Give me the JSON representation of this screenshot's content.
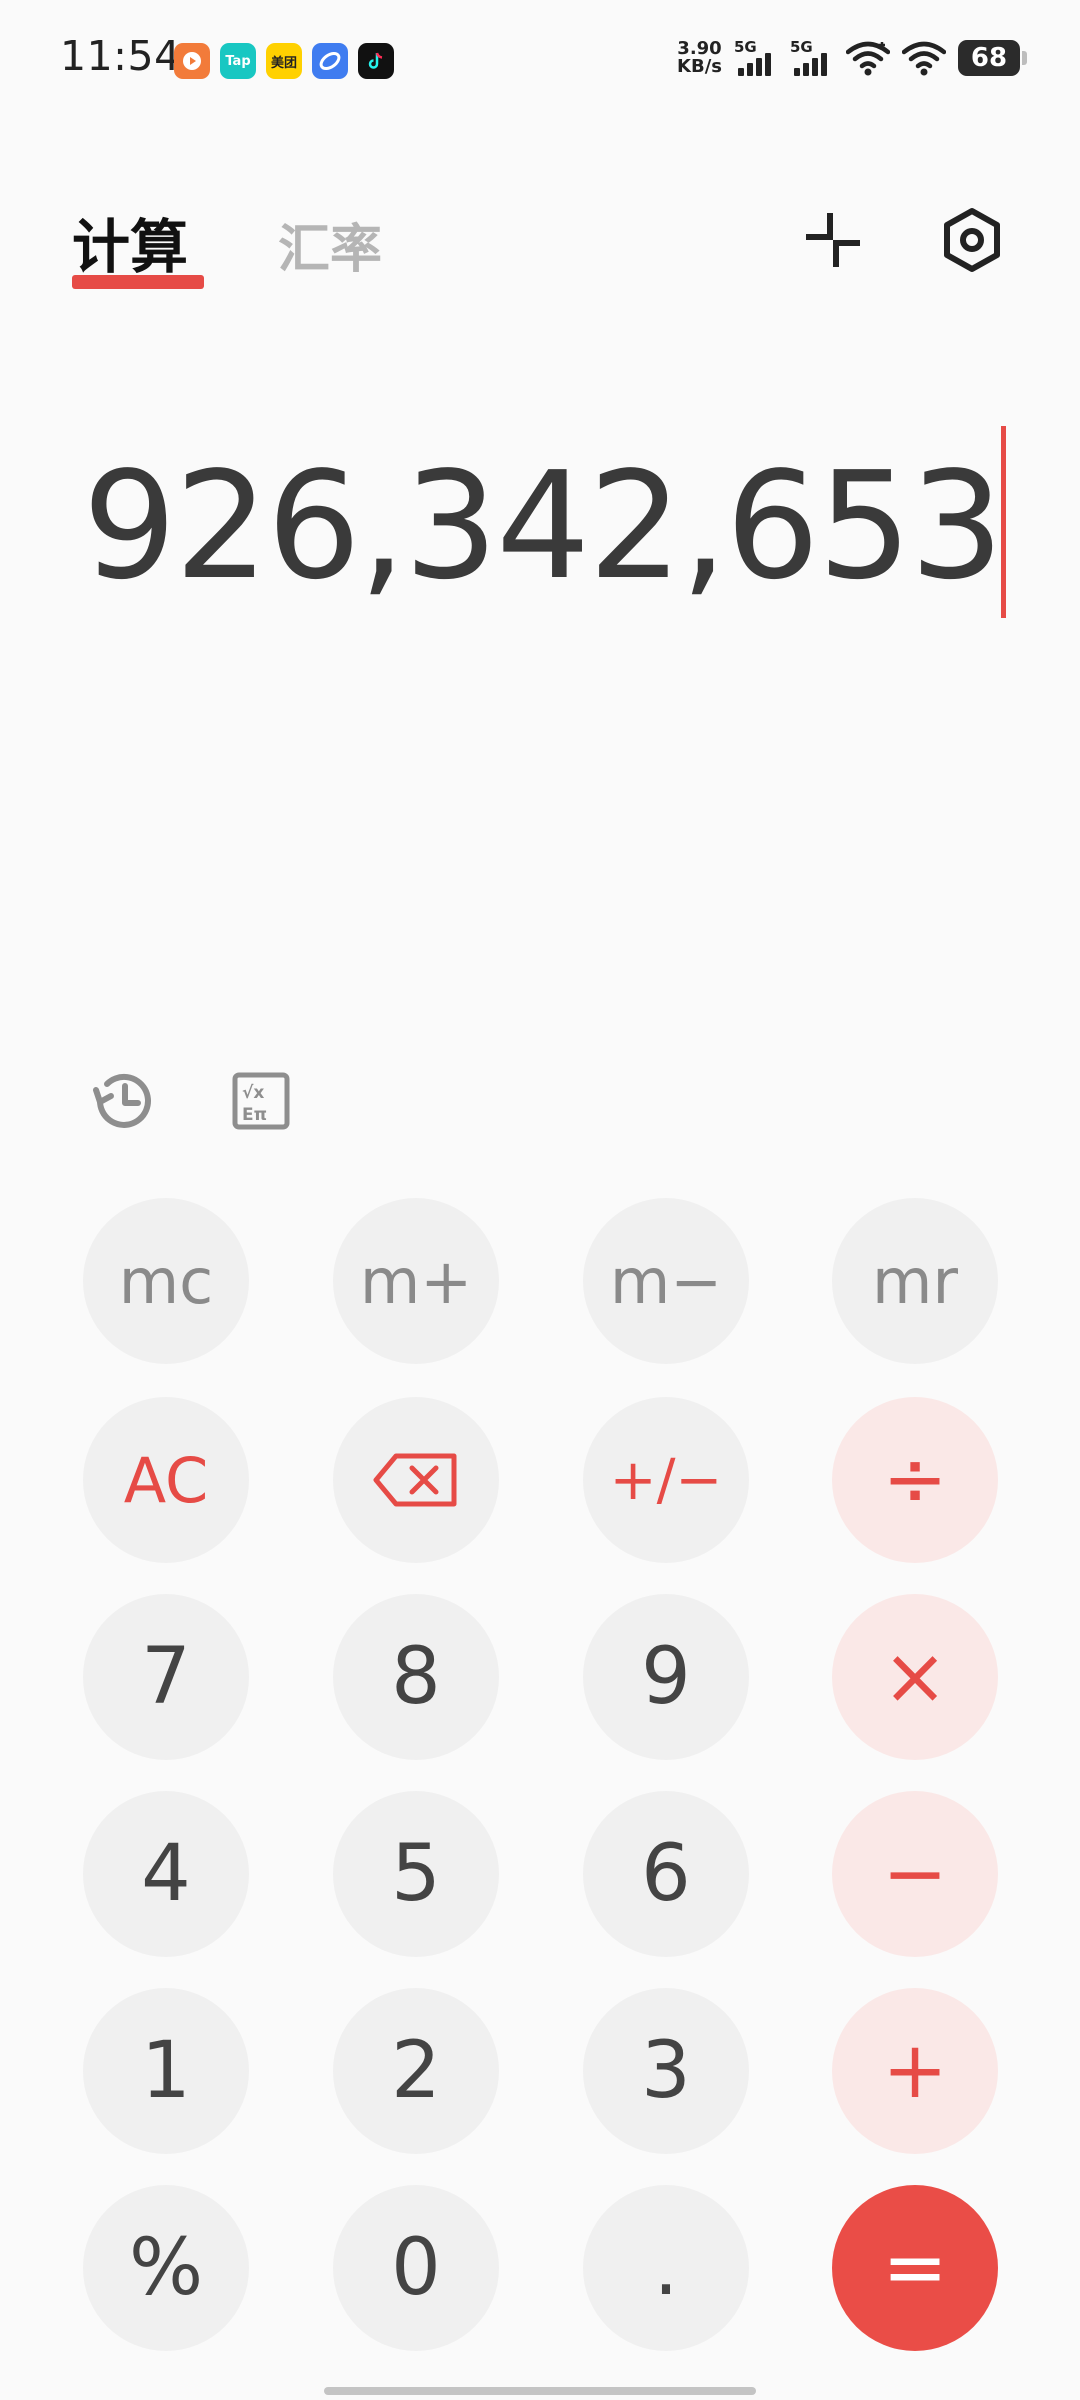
{
  "status_bar": {
    "time": "11:54",
    "apps": [
      {
        "name": "video-app-icon",
        "label": "",
        "color": "#f27b3a"
      },
      {
        "name": "taptap-app-icon",
        "label": "Tap",
        "color": "#18c7c2"
      },
      {
        "name": "meituan-app-icon",
        "label": "美团",
        "color": "#ffd100"
      },
      {
        "name": "browser-app-icon",
        "label": "",
        "color": "#3f7cf0"
      },
      {
        "name": "tiktok-app-icon",
        "label": "",
        "color": "#111111"
      }
    ],
    "net_speed_value": "3.90",
    "net_speed_unit": "KB/s",
    "sim1": "5G",
    "sim2": "5G",
    "battery": "68"
  },
  "tabs": {
    "calc": "计算",
    "rate": "汇率"
  },
  "display": {
    "value": "926,342,653"
  },
  "keypad": {
    "mc": "mc",
    "m_plus": "m+",
    "m_minus": "m−",
    "mr": "mr",
    "ac": "AC",
    "plus_minus": "+/−",
    "divide": "÷",
    "seven": "7",
    "eight": "8",
    "nine": "9",
    "multiply": "×",
    "four": "4",
    "five": "5",
    "six": "6",
    "minus": "−",
    "one": "1",
    "two": "2",
    "three": "3",
    "plus": "+",
    "percent": "%",
    "zero": "0",
    "dot": ".",
    "equals": "="
  },
  "colors": {
    "accent": "#e64b46",
    "operator_bg": "#fae8e7",
    "key_bg": "#f0f0f0",
    "background": "#fafafa"
  },
  "icons": {
    "compact": "compact-mode-icon",
    "settings": "settings-icon",
    "history": "history-icon",
    "scientific": "scientific-calculator-icon",
    "backspace": "backspace-icon"
  }
}
